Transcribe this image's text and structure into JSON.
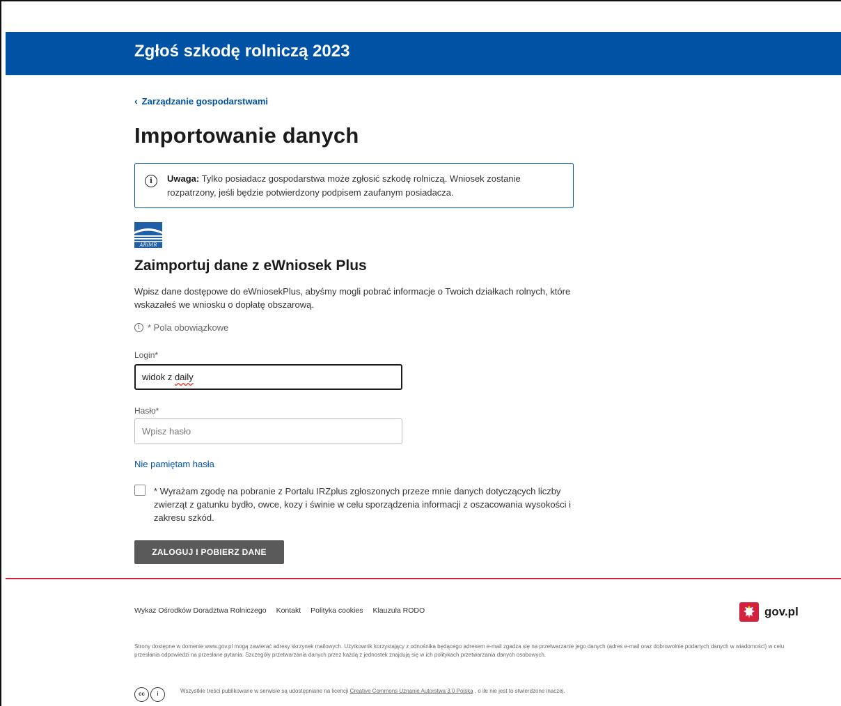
{
  "header": {
    "title": "Zgłoś szkodę rolniczą 2023"
  },
  "breadcrumb": {
    "back_label": "Zarządzanie gospodarstwami"
  },
  "page": {
    "title": "Importowanie danych"
  },
  "alert": {
    "strong": "Uwaga:",
    "text": " Tylko posiadacz gospodarstwa może zgłosić szkodę rolniczą. Wniosek zostanie rozpatrzony, jeśli będzie potwierdzony podpisem zaufanym posiadacza."
  },
  "section": {
    "logo_text": "ARiMR",
    "title": "Zaimportuj dane z eWniosek Plus",
    "description": "Wpisz dane dostępowe do eWniosekPlus, abyśmy mogli pobrać informacje o Twoich działkach rolnych, które wskazałeś we wniosku o dopłatę obszarową.",
    "required_note": "* Pola obowiązkowe"
  },
  "form": {
    "login_label": "Login*",
    "login_value_1": "widok z ",
    "login_value_2": "daily",
    "password_label": "Hasło*",
    "password_placeholder": "Wpisz hasło",
    "forgot_password": "Nie pamiętam hasła",
    "consent_text": "* Wyrażam zgodę na pobranie z Portalu IRZplus zgłoszonych przeze mnie danych dotyczących liczby zwierząt z gatunku bydło, owce, kozy i świnie w celu sporządzenia informacji z oszacowania wysokości i zakresu szkód.",
    "consent_checked": false,
    "submit_label": "ZALOGUJ I POBIERZ DANE"
  },
  "footer": {
    "links": [
      "Wykaz Ośrodków Doradztwa Rolniczego",
      "Kontakt",
      "Polityka cookies",
      "Klauzula RODO"
    ],
    "brand": "gov.pl",
    "disclaimer": "Strony dostępne w domenie www.gov.pl mogą zawierać adresy skrzynek mailowych. Użytkownik korzystający z odnośnika będącego adresem e-mail zgadza się na przetwarzanie jego danych (adres e-mail oraz dobrowolnie podanych danych w wiadomości) w celu przesłania odpowiedzi na przesłane pytania. Szczegóły przetwarzania danych przez każdą z jednostek znajdują się w ich politykach przetwarzania danych osobowych.",
    "license_prefix": "Wszystkie treści publikowane w serwisie są udostępniane na licencji ",
    "license_link": "Creative Commons Uznanie Autorstwa 3.0 Polska",
    "license_suffix": " , o ile nie jest to stwierdzone inaczej."
  },
  "colors": {
    "brand_blue": "#0052a5",
    "footer_red": "#d4213d",
    "button_gray": "#5a5a5a"
  }
}
